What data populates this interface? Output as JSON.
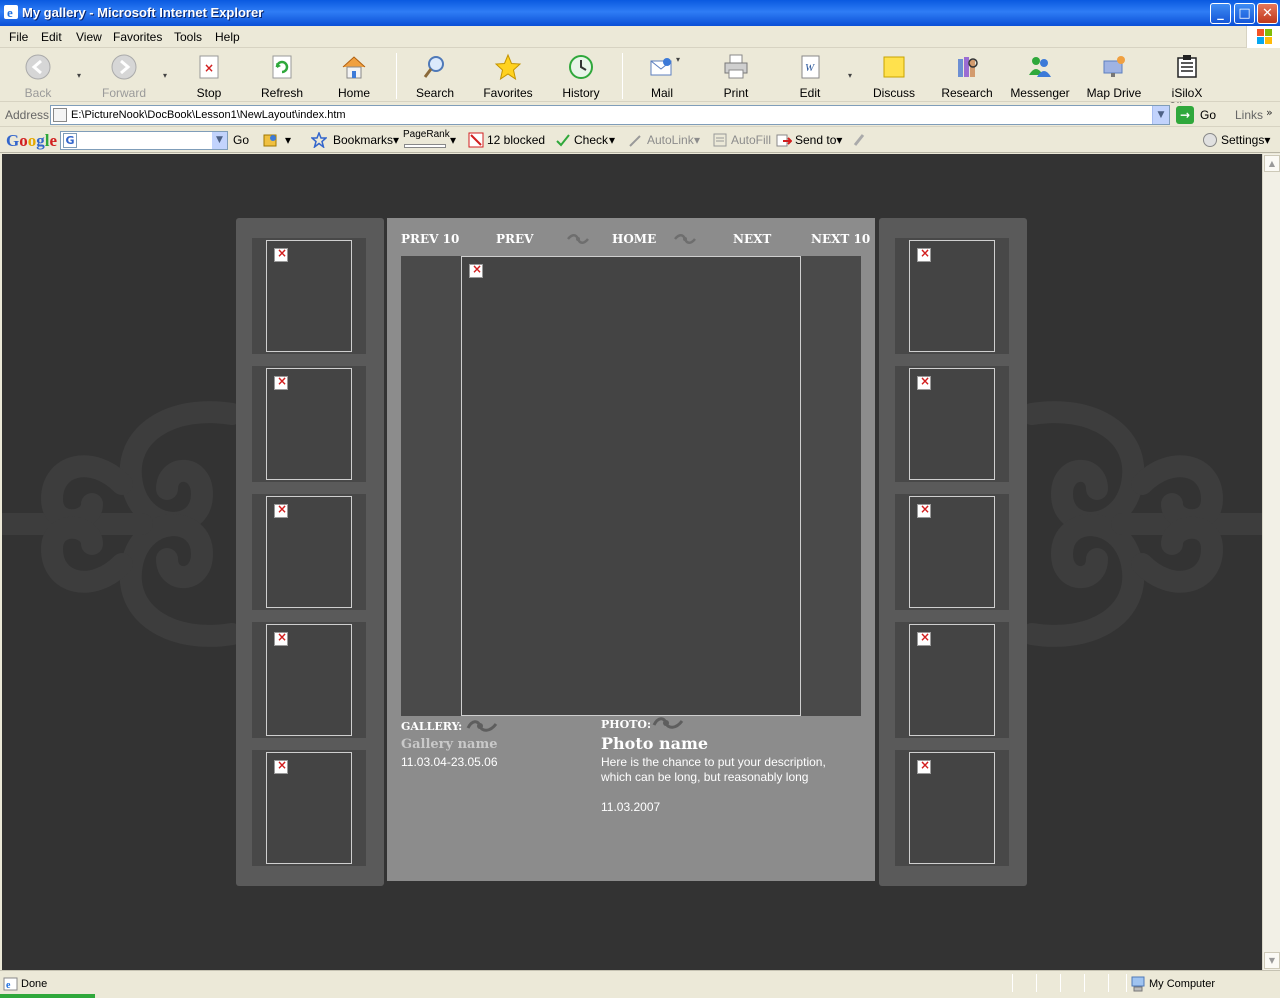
{
  "window": {
    "title": "My gallery - Microsoft Internet Explorer",
    "minimize": "_",
    "maximize": "□",
    "close": "✕"
  },
  "menu": {
    "items": [
      "File",
      "Edit",
      "View",
      "Favorites",
      "Tools",
      "Help"
    ]
  },
  "toolbar": {
    "back": "Back",
    "forward": "Forward",
    "stop": "Stop",
    "refresh": "Refresh",
    "home": "Home",
    "search": "Search",
    "favorites": "Favorites",
    "history": "History",
    "mail": "Mail",
    "print": "Print",
    "edit": "Edit",
    "discuss": "Discuss",
    "research": "Research",
    "messenger": "Messenger",
    "map_drive": "Map Drive",
    "isilox": "iSiloX Clipper"
  },
  "address": {
    "label": "Address",
    "value": "E:\\PictureNook\\DocBook\\Lesson1\\NewLayout\\index.htm",
    "go": "Go",
    "links": "Links"
  },
  "google_toolbar": {
    "logo": "Google",
    "go": "Go",
    "bookmarks": "Bookmarks▾",
    "pagerank": "PageRank",
    "blocked": "12 blocked",
    "check": "Check",
    "autolink": "AutoLink",
    "autofill": "AutoFill",
    "send_to": "Send to▾",
    "settings": "Settings▾"
  },
  "gallery": {
    "nav": {
      "prev10": "PREV 10",
      "prev": "PREV",
      "home": "HOME",
      "next": "NEXT",
      "next10": "NEXT 10"
    },
    "gallery_label": "GALLERY:",
    "gallery_name": "Gallery name",
    "gallery_dates": "11.03.04-23.05.06",
    "photo_label": "PHOTO:",
    "photo_name": "Photo name",
    "photo_description": "Here is the chance to put your description, which can be long, but reasonably long",
    "photo_date": "11.03.2007"
  },
  "status": {
    "text": "Done",
    "zone": "My Computer"
  },
  "colors": {
    "page_background": "#333333",
    "panel": "#5a5a5a",
    "main_panel": "#8c8c8c",
    "photo_area": "#4a4a4a"
  }
}
